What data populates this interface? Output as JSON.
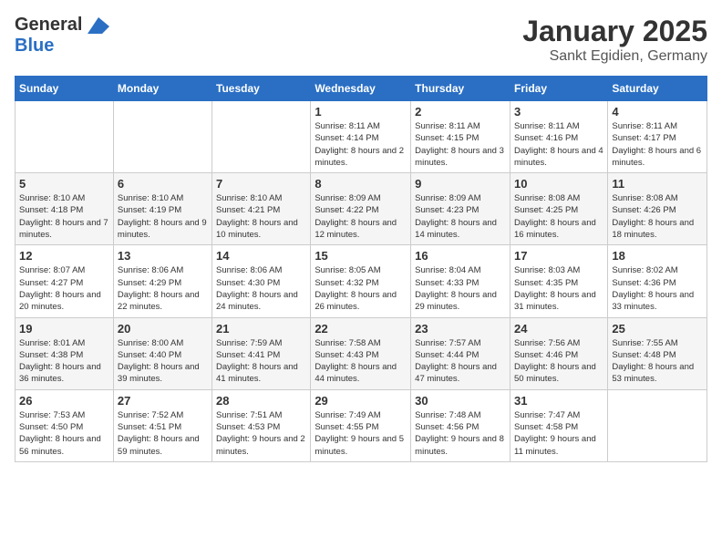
{
  "header": {
    "logo_general": "General",
    "logo_blue": "Blue",
    "month": "January 2025",
    "location": "Sankt Egidien, Germany"
  },
  "days_of_week": [
    "Sunday",
    "Monday",
    "Tuesday",
    "Wednesday",
    "Thursday",
    "Friday",
    "Saturday"
  ],
  "weeks": [
    [
      {
        "day": "",
        "info": ""
      },
      {
        "day": "",
        "info": ""
      },
      {
        "day": "",
        "info": ""
      },
      {
        "day": "1",
        "info": "Sunrise: 8:11 AM\nSunset: 4:14 PM\nDaylight: 8 hours and 2 minutes."
      },
      {
        "day": "2",
        "info": "Sunrise: 8:11 AM\nSunset: 4:15 PM\nDaylight: 8 hours and 3 minutes."
      },
      {
        "day": "3",
        "info": "Sunrise: 8:11 AM\nSunset: 4:16 PM\nDaylight: 8 hours and 4 minutes."
      },
      {
        "day": "4",
        "info": "Sunrise: 8:11 AM\nSunset: 4:17 PM\nDaylight: 8 hours and 6 minutes."
      }
    ],
    [
      {
        "day": "5",
        "info": "Sunrise: 8:10 AM\nSunset: 4:18 PM\nDaylight: 8 hours and 7 minutes."
      },
      {
        "day": "6",
        "info": "Sunrise: 8:10 AM\nSunset: 4:19 PM\nDaylight: 8 hours and 9 minutes."
      },
      {
        "day": "7",
        "info": "Sunrise: 8:10 AM\nSunset: 4:21 PM\nDaylight: 8 hours and 10 minutes."
      },
      {
        "day": "8",
        "info": "Sunrise: 8:09 AM\nSunset: 4:22 PM\nDaylight: 8 hours and 12 minutes."
      },
      {
        "day": "9",
        "info": "Sunrise: 8:09 AM\nSunset: 4:23 PM\nDaylight: 8 hours and 14 minutes."
      },
      {
        "day": "10",
        "info": "Sunrise: 8:08 AM\nSunset: 4:25 PM\nDaylight: 8 hours and 16 minutes."
      },
      {
        "day": "11",
        "info": "Sunrise: 8:08 AM\nSunset: 4:26 PM\nDaylight: 8 hours and 18 minutes."
      }
    ],
    [
      {
        "day": "12",
        "info": "Sunrise: 8:07 AM\nSunset: 4:27 PM\nDaylight: 8 hours and 20 minutes."
      },
      {
        "day": "13",
        "info": "Sunrise: 8:06 AM\nSunset: 4:29 PM\nDaylight: 8 hours and 22 minutes."
      },
      {
        "day": "14",
        "info": "Sunrise: 8:06 AM\nSunset: 4:30 PM\nDaylight: 8 hours and 24 minutes."
      },
      {
        "day": "15",
        "info": "Sunrise: 8:05 AM\nSunset: 4:32 PM\nDaylight: 8 hours and 26 minutes."
      },
      {
        "day": "16",
        "info": "Sunrise: 8:04 AM\nSunset: 4:33 PM\nDaylight: 8 hours and 29 minutes."
      },
      {
        "day": "17",
        "info": "Sunrise: 8:03 AM\nSunset: 4:35 PM\nDaylight: 8 hours and 31 minutes."
      },
      {
        "day": "18",
        "info": "Sunrise: 8:02 AM\nSunset: 4:36 PM\nDaylight: 8 hours and 33 minutes."
      }
    ],
    [
      {
        "day": "19",
        "info": "Sunrise: 8:01 AM\nSunset: 4:38 PM\nDaylight: 8 hours and 36 minutes."
      },
      {
        "day": "20",
        "info": "Sunrise: 8:00 AM\nSunset: 4:40 PM\nDaylight: 8 hours and 39 minutes."
      },
      {
        "day": "21",
        "info": "Sunrise: 7:59 AM\nSunset: 4:41 PM\nDaylight: 8 hours and 41 minutes."
      },
      {
        "day": "22",
        "info": "Sunrise: 7:58 AM\nSunset: 4:43 PM\nDaylight: 8 hours and 44 minutes."
      },
      {
        "day": "23",
        "info": "Sunrise: 7:57 AM\nSunset: 4:44 PM\nDaylight: 8 hours and 47 minutes."
      },
      {
        "day": "24",
        "info": "Sunrise: 7:56 AM\nSunset: 4:46 PM\nDaylight: 8 hours and 50 minutes."
      },
      {
        "day": "25",
        "info": "Sunrise: 7:55 AM\nSunset: 4:48 PM\nDaylight: 8 hours and 53 minutes."
      }
    ],
    [
      {
        "day": "26",
        "info": "Sunrise: 7:53 AM\nSunset: 4:50 PM\nDaylight: 8 hours and 56 minutes."
      },
      {
        "day": "27",
        "info": "Sunrise: 7:52 AM\nSunset: 4:51 PM\nDaylight: 8 hours and 59 minutes."
      },
      {
        "day": "28",
        "info": "Sunrise: 7:51 AM\nSunset: 4:53 PM\nDaylight: 9 hours and 2 minutes."
      },
      {
        "day": "29",
        "info": "Sunrise: 7:49 AM\nSunset: 4:55 PM\nDaylight: 9 hours and 5 minutes."
      },
      {
        "day": "30",
        "info": "Sunrise: 7:48 AM\nSunset: 4:56 PM\nDaylight: 9 hours and 8 minutes."
      },
      {
        "day": "31",
        "info": "Sunrise: 7:47 AM\nSunset: 4:58 PM\nDaylight: 9 hours and 11 minutes."
      },
      {
        "day": "",
        "info": ""
      }
    ]
  ]
}
